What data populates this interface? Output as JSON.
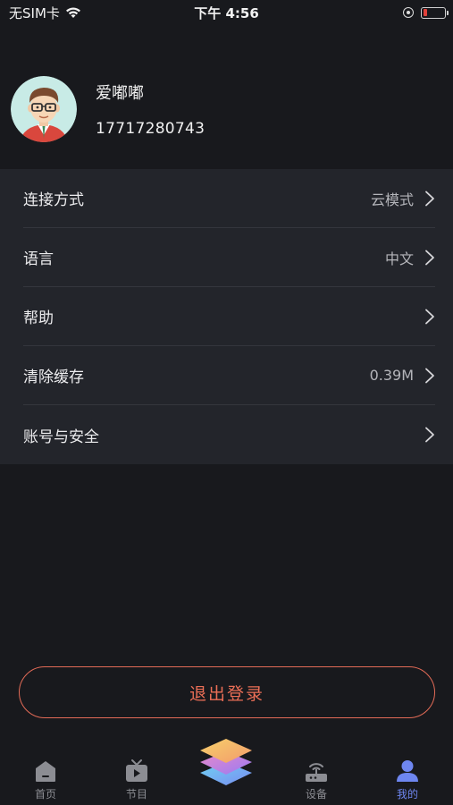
{
  "status_bar": {
    "carrier": "无SIM卡",
    "time": "下午 4:56"
  },
  "profile": {
    "name": "爱嘟嘟",
    "phone": "17717280743"
  },
  "settings": {
    "items": [
      {
        "label": "连接方式",
        "value": "云模式"
      },
      {
        "label": "语言",
        "value": "中文"
      },
      {
        "label": "帮助",
        "value": ""
      },
      {
        "label": "清除缓存",
        "value": "0.39M"
      },
      {
        "label": "账号与安全",
        "value": ""
      }
    ]
  },
  "logout": {
    "label": "退出登录"
  },
  "tabbar": {
    "tabs": [
      {
        "label": "首页",
        "icon": "home-icon"
      },
      {
        "label": "节目",
        "icon": "tv-icon"
      },
      {
        "label": "",
        "icon": "layers-icon"
      },
      {
        "label": "设备",
        "icon": "router-icon"
      },
      {
        "label": "我的",
        "icon": "person-icon"
      }
    ],
    "active_color": "#6e86f0",
    "inactive_color": "#8c8d93"
  },
  "colors": {
    "background": "#18191d",
    "panel": "#23252b",
    "logout_accent": "#e36b57",
    "battery_low": "#e0413a"
  }
}
